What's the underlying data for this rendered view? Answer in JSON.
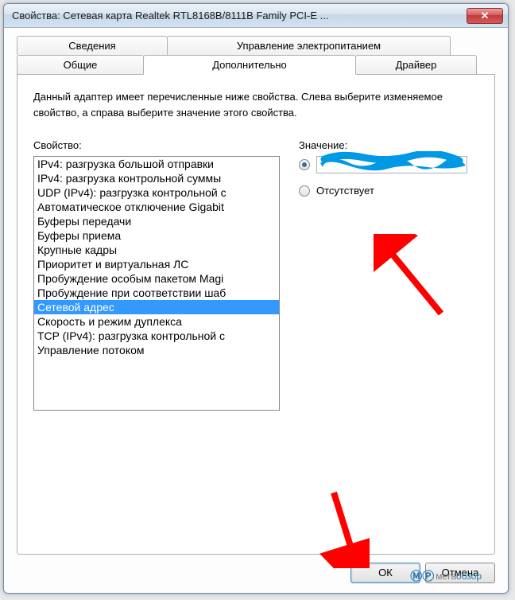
{
  "window": {
    "title": "Свойства: Сетевая карта Realtek RTL8168B/8111B Family PCI-E ..."
  },
  "tabs": {
    "row1": [
      "Сведения",
      "Управление электропитанием"
    ],
    "row2": [
      "Общие",
      "Дополнительно",
      "Драйвер"
    ],
    "active": "Дополнительно"
  },
  "panel": {
    "description": "Данный адаптер имеет перечисленные ниже свойства. Слева выберите изменяемое свойство, а справа выберите значение этого свойства.",
    "property_label": "Свойство:",
    "value_label": "Значение:",
    "properties": [
      "IPv4: разгрузка большой отправки",
      "IPv4: разгрузка контрольной суммы",
      "UDP (IPv4): разгрузка контрольной с",
      "Автоматическое отключение Gigabit",
      "Буферы передачи",
      "Буферы приема",
      "Крупные кадры",
      "Приоритет и виртуальная ЛС",
      "Пробуждение особым пакетом Magi",
      "Пробуждение при соответствии шаб",
      "Сетевой адрес",
      "Скорость и режим дуплекса",
      "TCP (IPv4): разгрузка контрольной с",
      "Управление потоком"
    ],
    "selected_index": 10,
    "value_radio_selected": true,
    "value_input": "",
    "absent_label": "Отсутствует"
  },
  "buttons": {
    "ok": "ОК",
    "cancel": "Отмена"
  },
  "watermark": {
    "prefix": "мега",
    "suffix": "обзор"
  }
}
